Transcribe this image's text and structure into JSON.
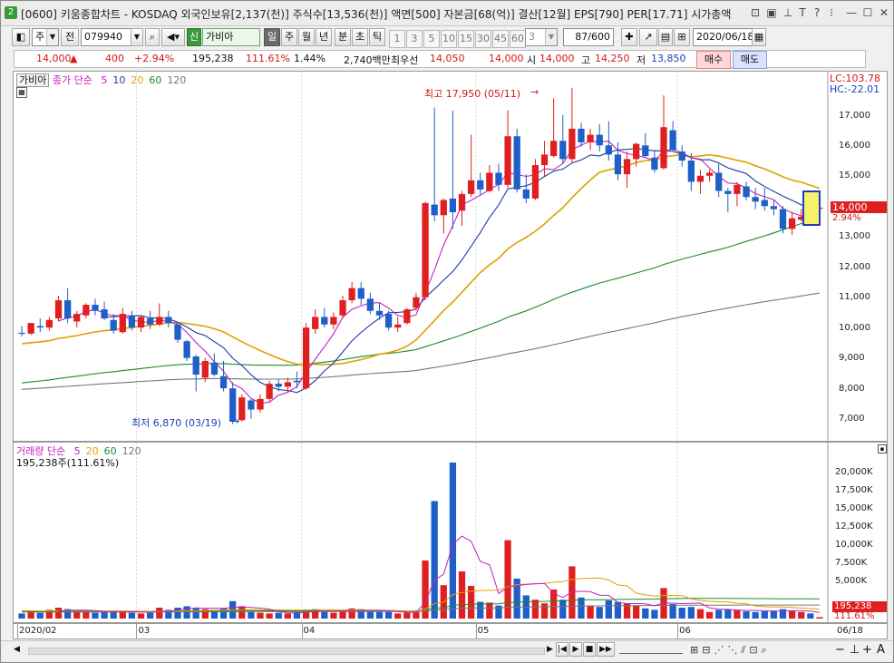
{
  "window": {
    "badge": "2",
    "title": "[0600] 키움종합차트 - KOSDAQ 외국인보유[2,137(천)] 주식수[13,536(천)] 액면[500] 자본금[68(억)] 결산[12월] EPS[790] PER[17.71] 시가총액"
  },
  "toolbar": {
    "period_type": "주",
    "prev_label": "전",
    "code": "079940",
    "credit_badge": "신",
    "name": "가비아",
    "tf_day": "일",
    "tf_week": "주",
    "tf_month": "월",
    "tf_year": "년",
    "tf_minute": "분",
    "tf_second": "초",
    "tf_tick": "틱",
    "intervals": [
      "1",
      "3",
      "5",
      "10",
      "15",
      "30",
      "45",
      "60"
    ],
    "interval_sel": "3",
    "count": "87/600",
    "date": "2020/06/18"
  },
  "quote": {
    "price": "14,000",
    "change": "400",
    "change_pct": "+2.94%",
    "volume": "195,238",
    "vol_ratio": "111.61%",
    "turnover": "1.44%",
    "amount": "2,740백만",
    "best_bid_label": "최우선",
    "bid": "14,050",
    "ask": "14,000",
    "open_label": "시",
    "open": "14,000",
    "high_label": "고",
    "high": "14,250",
    "low_label": "저",
    "low": "13,850",
    "buy": "매수",
    "sell": "매도"
  },
  "price_panel": {
    "name_tag": "가비아",
    "legend_prefix": "종가 단순",
    "ma": [
      {
        "label": "5",
        "color": "#c020c0"
      },
      {
        "label": "10",
        "color": "#1e3aa0"
      },
      {
        "label": "20",
        "color": "#e0a000"
      },
      {
        "label": "60",
        "color": "#1a8a2a"
      },
      {
        "label": "120",
        "color": "#777777"
      }
    ],
    "lc": "LC:103.78",
    "hc": "HC:-22.01",
    "high_annot": "최고 17,950 (05/11)",
    "low_annot": "최저 6,870 (03/19)",
    "cur_price": "14,000",
    "cur_pct": "2.94%",
    "yticks": [
      "17,000",
      "16,000",
      "15,000",
      "14,000",
      "13,000",
      "12,000",
      "11,000",
      "10,000",
      "9,000",
      "8,000",
      "7,000"
    ]
  },
  "vol_panel": {
    "legend_prefix": "거래량 단순",
    "ma": [
      {
        "label": "5",
        "color": "#c020c0"
      },
      {
        "label": "20",
        "color": "#e0a000"
      },
      {
        "label": "60",
        "color": "#1a8a2a"
      },
      {
        "label": "120",
        "color": "#777777"
      }
    ],
    "info": "195,238주(111.61%)",
    "yticks": [
      "20,000K",
      "17,500K",
      "15,000K",
      "12,500K",
      "10,000K",
      "7,500K",
      "5,000K"
    ],
    "cur_vol": "195,238",
    "cur_pct": "111.61%"
  },
  "xaxis": {
    "labels": [
      "2020/02",
      "03",
      "04",
      "05",
      "06"
    ],
    "right_label": "06/18"
  },
  "colors": {
    "up": "#e02020",
    "down": "#1f5fc8"
  },
  "chart_data": {
    "type": "candlestick",
    "title": "가비아",
    "ylim": [
      6500,
      18300
    ],
    "vol_ylim": [
      0,
      22000
    ],
    "candles": [
      [
        9880,
        10100,
        9750,
        9850,
        700,
        "02"
      ],
      [
        9850,
        10200,
        9800,
        10200,
        900,
        ""
      ],
      [
        10100,
        10350,
        9900,
        10050,
        800,
        ""
      ],
      [
        10050,
        10400,
        9950,
        10300,
        1200,
        ""
      ],
      [
        10350,
        11100,
        10250,
        10950,
        1500,
        ""
      ],
      [
        10950,
        11350,
        10200,
        10350,
        1300,
        ""
      ],
      [
        10250,
        10600,
        10050,
        10500,
        1000,
        ""
      ],
      [
        10450,
        10850,
        10350,
        10800,
        900,
        ""
      ],
      [
        10800,
        11000,
        10450,
        10600,
        800,
        ""
      ],
      [
        10650,
        10900,
        10300,
        10350,
        900,
        ""
      ],
      [
        10300,
        10500,
        9850,
        9950,
        1100,
        ""
      ],
      [
        9900,
        10700,
        9850,
        10500,
        1000,
        ""
      ],
      [
        10450,
        10600,
        9950,
        10050,
        800,
        ""
      ],
      [
        10050,
        10450,
        9900,
        10400,
        700,
        "03"
      ],
      [
        10350,
        10600,
        10000,
        10150,
        800,
        ""
      ],
      [
        10150,
        10850,
        10100,
        10400,
        1500,
        ""
      ],
      [
        10400,
        10600,
        10050,
        10200,
        1200,
        ""
      ],
      [
        10150,
        10250,
        9550,
        9650,
        1500,
        ""
      ],
      [
        9600,
        9650,
        8950,
        9050,
        1700,
        ""
      ],
      [
        9100,
        9150,
        7950,
        8500,
        1400,
        ""
      ],
      [
        8400,
        9050,
        8250,
        8950,
        1300,
        ""
      ],
      [
        8900,
        9200,
        8450,
        8500,
        1200,
        ""
      ],
      [
        8450,
        8950,
        7950,
        8050,
        1400,
        ""
      ],
      [
        8050,
        8250,
        6870,
        6950,
        2400,
        ""
      ],
      [
        7000,
        7850,
        6950,
        7750,
        1700,
        ""
      ],
      [
        7650,
        7700,
        7050,
        7350,
        900,
        ""
      ],
      [
        7350,
        7850,
        7250,
        7700,
        800,
        ""
      ],
      [
        7700,
        8300,
        7600,
        8200,
        700,
        ""
      ],
      [
        8200,
        8350,
        7950,
        8100,
        800,
        ""
      ],
      [
        8100,
        8400,
        7900,
        8250,
        700,
        ""
      ],
      [
        8300,
        8600,
        8050,
        8250,
        900,
        ""
      ],
      [
        8050,
        10200,
        8000,
        10050,
        1200,
        "04"
      ],
      [
        10000,
        10650,
        9850,
        10400,
        1300,
        ""
      ],
      [
        10400,
        10700,
        10050,
        10150,
        900,
        ""
      ],
      [
        10150,
        10550,
        10000,
        10400,
        800,
        ""
      ],
      [
        10450,
        11100,
        10350,
        10950,
        1100,
        ""
      ],
      [
        10950,
        11550,
        10850,
        11350,
        1400,
        ""
      ],
      [
        11350,
        11550,
        10800,
        11000,
        1300,
        ""
      ],
      [
        11000,
        11200,
        10500,
        10600,
        1000,
        ""
      ],
      [
        10600,
        10850,
        10300,
        10450,
        900,
        ""
      ],
      [
        10500,
        10600,
        9950,
        10050,
        900,
        ""
      ],
      [
        10050,
        10400,
        9900,
        10150,
        700,
        ""
      ],
      [
        10200,
        10700,
        10150,
        10650,
        800,
        ""
      ],
      [
        10700,
        11200,
        10600,
        11050,
        900,
        ""
      ],
      [
        11050,
        14200,
        10950,
        14150,
        8000,
        ""
      ],
      [
        14100,
        17300,
        13550,
        13750,
        16200,
        ""
      ],
      [
        13750,
        14300,
        13150,
        14250,
        4600,
        ""
      ],
      [
        14300,
        17200,
        13300,
        13850,
        21500,
        ""
      ],
      [
        13900,
        14550,
        13400,
        14450,
        6500,
        ""
      ],
      [
        14450,
        16400,
        14350,
        14900,
        4500,
        ""
      ],
      [
        14900,
        15150,
        14400,
        14600,
        2300,
        "05"
      ],
      [
        14550,
        15400,
        14500,
        15150,
        2200,
        ""
      ],
      [
        15150,
        15450,
        14550,
        14750,
        1800,
        ""
      ],
      [
        14750,
        17200,
        14650,
        16350,
        10800,
        ""
      ],
      [
        16350,
        16600,
        14500,
        14600,
        5500,
        ""
      ],
      [
        14600,
        15100,
        14150,
        14300,
        3200,
        ""
      ],
      [
        14300,
        15600,
        14250,
        15400,
        2600,
        ""
      ],
      [
        15400,
        16200,
        15050,
        15750,
        2100,
        ""
      ],
      [
        15700,
        17600,
        15650,
        16200,
        4000,
        ""
      ],
      [
        16200,
        17050,
        15450,
        15600,
        2600,
        ""
      ],
      [
        15600,
        17950,
        15450,
        16600,
        7200,
        ""
      ],
      [
        16600,
        16800,
        16000,
        16150,
        2900,
        ""
      ],
      [
        16150,
        16600,
        15900,
        16400,
        1800,
        ""
      ],
      [
        16400,
        16750,
        15850,
        16050,
        1600,
        ""
      ],
      [
        16050,
        16850,
        15550,
        15750,
        2500,
        ""
      ],
      [
        15750,
        16150,
        14900,
        15100,
        2300,
        ""
      ],
      [
        15100,
        15850,
        14650,
        15600,
        2100,
        ""
      ],
      [
        15600,
        16150,
        15350,
        16100,
        1800,
        ""
      ],
      [
        16050,
        16450,
        15650,
        15700,
        1400,
        ""
      ],
      [
        15650,
        15900,
        15150,
        15250,
        1200,
        ""
      ],
      [
        15300,
        17700,
        15250,
        16650,
        4200,
        ""
      ],
      [
        16550,
        16850,
        15850,
        15900,
        2000,
        ""
      ],
      [
        15850,
        16050,
        15350,
        15550,
        1500,
        "06"
      ],
      [
        15550,
        15800,
        14550,
        14850,
        1600,
        ""
      ],
      [
        14850,
        15250,
        14450,
        15050,
        1300,
        ""
      ],
      [
        15050,
        15250,
        14850,
        15150,
        900,
        ""
      ],
      [
        15150,
        15450,
        14350,
        14550,
        1200,
        ""
      ],
      [
        14550,
        14650,
        13850,
        14450,
        1300,
        ""
      ],
      [
        14450,
        14850,
        14050,
        14750,
        1200,
        ""
      ],
      [
        14700,
        14850,
        14250,
        14350,
        1000,
        ""
      ],
      [
        14350,
        14650,
        13950,
        14200,
        900,
        ""
      ],
      [
        14250,
        14650,
        13900,
        14050,
        1000,
        ""
      ],
      [
        14050,
        14250,
        13750,
        13950,
        1100,
        ""
      ],
      [
        13950,
        14050,
        13150,
        13300,
        1300,
        ""
      ],
      [
        13300,
        13850,
        13100,
        13650,
        1100,
        ""
      ],
      [
        13600,
        13950,
        13550,
        13700,
        900,
        ""
      ],
      [
        13650,
        13900,
        13550,
        13600,
        700,
        ""
      ],
      [
        14000,
        14250,
        13850,
        14000,
        195,
        ""
      ]
    ]
  }
}
